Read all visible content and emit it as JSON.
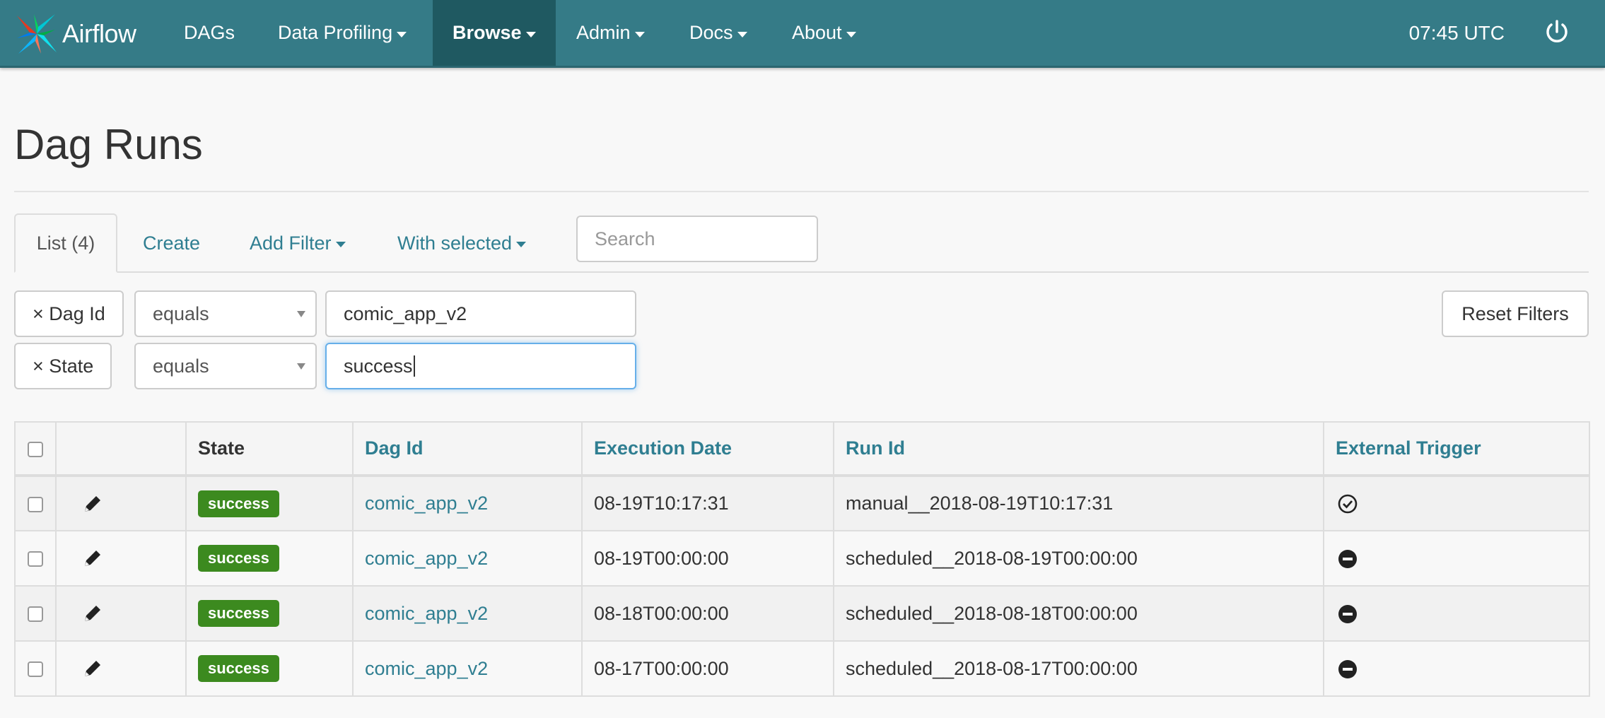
{
  "navbar": {
    "brand": "Airflow",
    "items": [
      {
        "label": "DAGs",
        "dropdown": false
      },
      {
        "label": "Data Profiling",
        "dropdown": true
      },
      {
        "label": "Browse",
        "dropdown": true,
        "active": true
      },
      {
        "label": "Admin",
        "dropdown": true
      },
      {
        "label": "Docs",
        "dropdown": true
      },
      {
        "label": "About",
        "dropdown": true
      }
    ],
    "clock": "07:45 UTC",
    "power_icon": "power-icon"
  },
  "page": {
    "title": "Dag Runs"
  },
  "tabs": {
    "list": "List (4)",
    "create": "Create",
    "add_filter": "Add Filter",
    "with_selected": "With selected"
  },
  "search": {
    "placeholder": "Search",
    "value": ""
  },
  "filters": [
    {
      "remove_label": "× Dag Id",
      "operator": "equals",
      "value": "comic_app_v2"
    },
    {
      "remove_label": "× State",
      "operator": "equals",
      "value": "success"
    }
  ],
  "reset_filters": "Reset Filters",
  "table": {
    "headers": {
      "state": "State",
      "dag_id": "Dag Id",
      "execution_date": "Execution Date",
      "run_id": "Run Id",
      "external_trigger": "External Trigger"
    },
    "rows": [
      {
        "state": "success",
        "dag_id": "comic_app_v2",
        "execution_date": "08-19T10:17:31",
        "run_id": "manual__2018-08-19T10:17:31",
        "external_trigger": "check-circle-icon"
      },
      {
        "state": "success",
        "dag_id": "comic_app_v2",
        "execution_date": "08-19T00:00:00",
        "run_id": "scheduled__2018-08-19T00:00:00",
        "external_trigger": "minus-circle-icon"
      },
      {
        "state": "success",
        "dag_id": "comic_app_v2",
        "execution_date": "08-18T00:00:00",
        "run_id": "scheduled__2018-08-18T00:00:00",
        "external_trigger": "minus-circle-icon"
      },
      {
        "state": "success",
        "dag_id": "comic_app_v2",
        "execution_date": "08-17T00:00:00",
        "run_id": "scheduled__2018-08-17T00:00:00",
        "external_trigger": "minus-circle-icon"
      }
    ]
  },
  "colors": {
    "navbar": "#357b87",
    "navbar_active": "#1f5961",
    "link": "#2f7e91",
    "success_badge": "#3c8a1f"
  }
}
